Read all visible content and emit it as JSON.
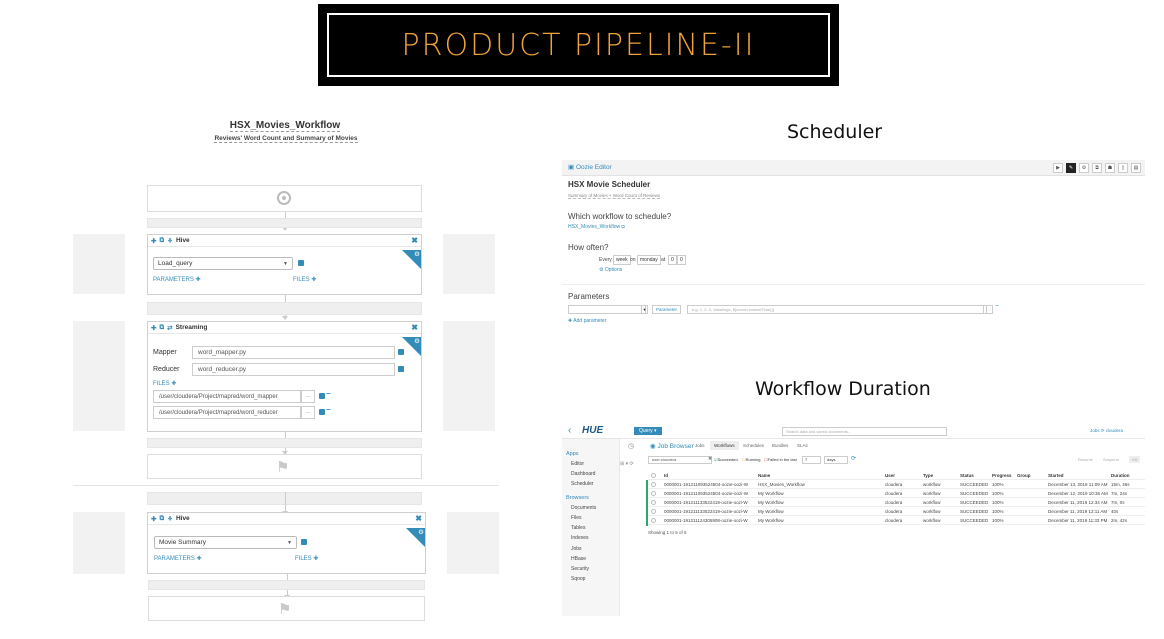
{
  "banner": {
    "title": "PRODUCT PIPELINE-II"
  },
  "workflow": {
    "name": "HSX_Movies_Workflow",
    "subtitle": "Reviews' Word Count and Summary of Movies",
    "hive1": {
      "type": "Hive",
      "query": "Load_query",
      "parameters": "PARAMETERS ✚",
      "files": "FILES ✚"
    },
    "streaming": {
      "type": "Streaming",
      "mapper_label": "Mapper",
      "mapper_value": "word_mapper.py",
      "reducer_label": "Reducer",
      "reducer_value": "word_reducer.py",
      "files": "FILES ✚",
      "file1": "/user/cloudera/Project/mapred/word_mapper",
      "file2": "/user/cloudera/Project/mapred/word_reducer"
    },
    "hive2": {
      "type": "Hive",
      "query": "Movie Summary",
      "parameters": "PARAMETERS ✚",
      "files": "FILES ✚"
    }
  },
  "scheduler": {
    "label": "Scheduler",
    "app": "Oozie Editor",
    "title": "HSX Movie Scheduler",
    "desc": "Summary of Movies + Word Count of Reviews",
    "q_workflow": "Which workflow to schedule?",
    "workflow_link": "HSX_Movies_Workflow",
    "q_often": "How often?",
    "every": "Every",
    "unit": "week",
    "on": "on",
    "day": "monday",
    "at": "at",
    "h": "0",
    "m": "0",
    "options": "Options",
    "params_title": "Parameters",
    "param_type": "Parameter",
    "param_placeholder": "e.g. 1, 2, 3, /data/logs, ${coord:nominalTime()}",
    "add_param": "✚ Add parameter"
  },
  "duration": {
    "label": "Workflow Duration",
    "logo": "HUE",
    "query_btn": "Query",
    "search_placeholder": "Search data and saved documents...",
    "user_links": "Jobs  ⟳  cloudera",
    "side_apps": "Apps",
    "side_items": [
      "Editor",
      "Dashboard",
      "Scheduler"
    ],
    "side_browsers": "Browsers",
    "side_items2": [
      "Documents",
      "Files",
      "Tables",
      "Indexes",
      "Jobs",
      "HBase",
      "Security",
      "Sqoop"
    ],
    "page_title": "Job Browser",
    "tabs": [
      "Jobs",
      "Workflows",
      "Schedules",
      "Bundles",
      "SLAs"
    ],
    "filter_user": "user:cloudera",
    "f_succeeded": "Succeeded",
    "f_running": "Running",
    "f_failed": "Failed in the last",
    "f_num": "7",
    "f_unit": "days",
    "btn_resume": "Resume",
    "btn_suspend": "Suspend",
    "btn_kill": "Kill",
    "headers": [
      "Id",
      "Name",
      "User",
      "Type",
      "Status",
      "Progress",
      "Group",
      "Started",
      "Duration"
    ],
    "rows": [
      [
        "0000001-191211093524504-oozie-oozi-W",
        "HSX_Movies_Workflow",
        "cloudera",
        "workflow",
        "SUCCEEDED",
        "100%",
        "",
        "December 13, 2019 11:09 AM",
        "15m, 46s"
      ],
      [
        "0000001-191211093524504-oozie-oozi-W",
        "My Workflow",
        "cloudera",
        "workflow",
        "SUCCEEDED",
        "100%",
        "",
        "December 12, 2019 10:36 AM",
        "7m, 24s"
      ],
      [
        "0000001-191211133522419-oozie-oozi-W",
        "My Workflow",
        "cloudera",
        "workflow",
        "SUCCEEDED",
        "100%",
        "",
        "December 11, 2019 12:34 AM",
        "7m, 0s"
      ],
      [
        "0000001-191211133522419-oozie-oozi-W",
        "My Workflow",
        "cloudera",
        "workflow",
        "SUCCEEDED",
        "100%",
        "",
        "December 11, 2019 12:11 AM",
        "40s"
      ],
      [
        "0000001-191211124305908-oozie-oozi-W",
        "My Workflow",
        "cloudera",
        "workflow",
        "SUCCEEDED",
        "100%",
        "",
        "December 11, 2019 11:33 PM",
        "2m, 42s"
      ]
    ],
    "footer": "Showing 1 to 5 of 5"
  }
}
